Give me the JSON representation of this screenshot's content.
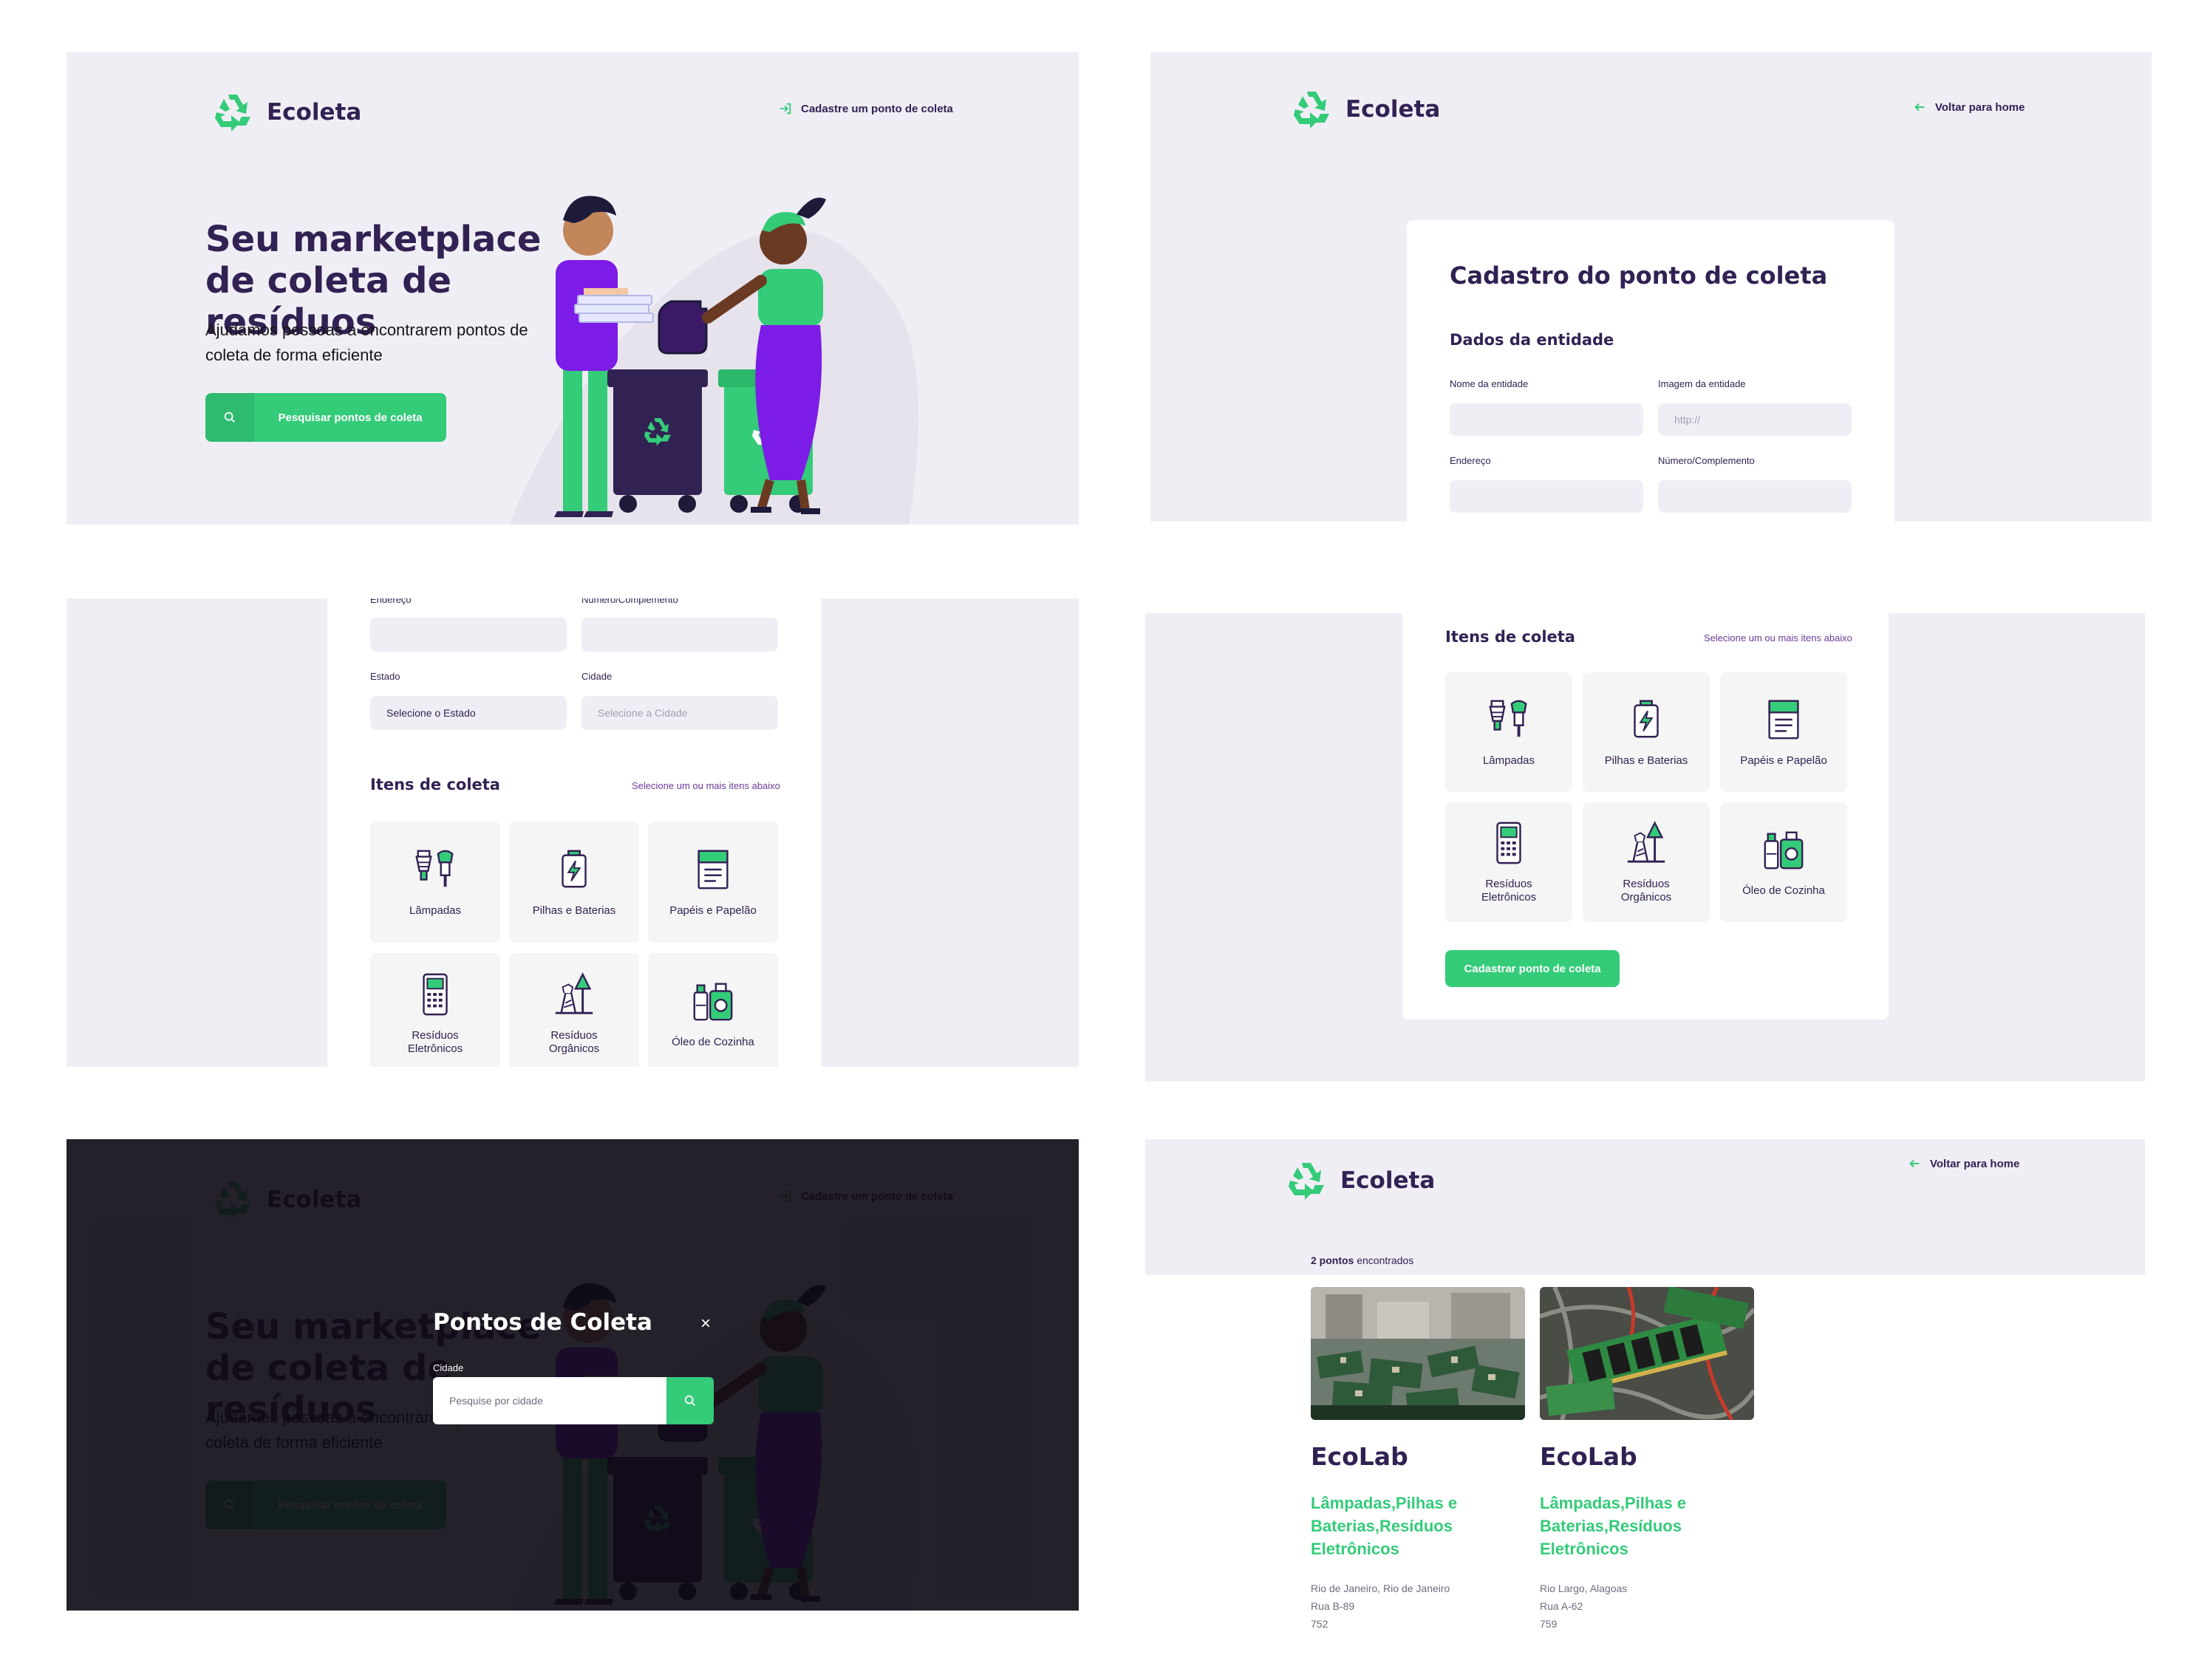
{
  "brand": {
    "name": "Ecoleta"
  },
  "home": {
    "nav_link": "Cadastre um ponto de coleta",
    "title": "Seu marketplace de coleta de resíduos",
    "description": "Ajudamos pessoas a encontrarem pontos de coleta de forma eficiente",
    "search_button": "Pesquisar pontos de coleta"
  },
  "create_point": {
    "back_link": "Voltar para home",
    "title": "Cadastro do ponto de coleta",
    "section_entity": "Dados da entidade",
    "fields": {
      "name_label": "Nome da entidade",
      "image_label": "Imagem da entidade",
      "image_placeholder": "http://",
      "address_label": "Endereço",
      "number_label": "Número/Complemento",
      "state_label": "Estado",
      "state_value": "Selecione o Estado",
      "city_label": "Cidade",
      "city_value": "Selecione a Cidade"
    },
    "items_title": "Itens de coleta",
    "items_hint": "Selecione um ou mais itens abaixo",
    "items": [
      {
        "label": "Lâmpadas",
        "icon": "lamp-icon"
      },
      {
        "label": "Pilhas e Baterias",
        "icon": "battery-icon"
      },
      {
        "label": "Papéis e Papelão",
        "icon": "paper-icon"
      },
      {
        "label": "Resíduos Eletrônicos",
        "icon": "electronics-icon"
      },
      {
        "label": "Resíduos Orgânicos",
        "icon": "organic-icon"
      },
      {
        "label": "Óleo de Cozinha",
        "icon": "oil-icon"
      }
    ],
    "submit_button": "Cadastrar ponto de coleta"
  },
  "modal": {
    "title": "Pontos de Coleta",
    "city_label": "Cidade",
    "city_placeholder": "Pesquise por cidade"
  },
  "results": {
    "back_link": "Voltar para home",
    "count_strong": "2 pontos",
    "count_rest": "encontrados",
    "places": [
      {
        "name": "EcoLab",
        "items": "Lâmpadas,Pilhas e Baterias,Resíduos Eletrônicos",
        "city": "Rio de Janeiro, Rio de Janeiro",
        "street": "Rua B-89",
        "number": "752"
      },
      {
        "name": "EcoLab",
        "items": "Lâmpadas,Pilhas e Baterias,Resíduos Eletrônicos",
        "city": "Rio Largo, Alagoas",
        "street": "Rua A-62",
        "number": "759"
      }
    ]
  },
  "colors": {
    "primary": "#34cb79",
    "title": "#322153",
    "background": "#f0eef5",
    "overlay": "#0e0a14"
  }
}
